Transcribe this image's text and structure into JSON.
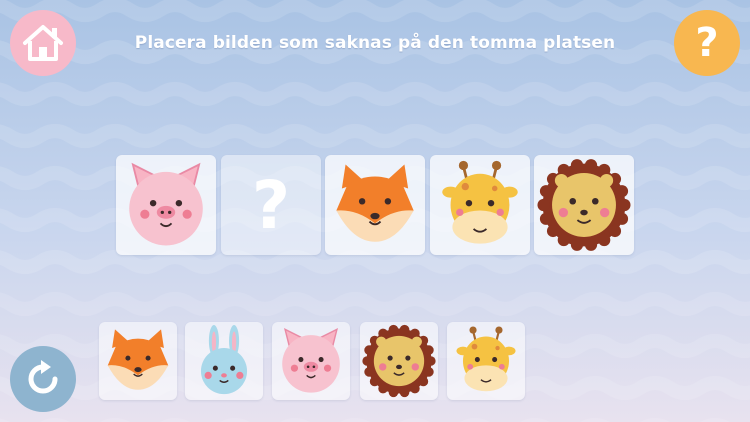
{
  "header": {
    "title": "Placera bilden som saknas på den tomma platsen",
    "home_icon": "home-icon",
    "help_label": "?",
    "help_color": "#f8b750",
    "home_color": "#f7b9c9"
  },
  "sequence": {
    "items": [
      "pig",
      "missing",
      "fox",
      "giraffe",
      "lion"
    ],
    "missing_label": "?"
  },
  "choices": {
    "items": [
      "fox",
      "bunny",
      "pig",
      "lion",
      "giraffe"
    ]
  },
  "footer": {
    "refresh_icon": "refresh-icon",
    "refresh_color": "#8eb4cf"
  }
}
